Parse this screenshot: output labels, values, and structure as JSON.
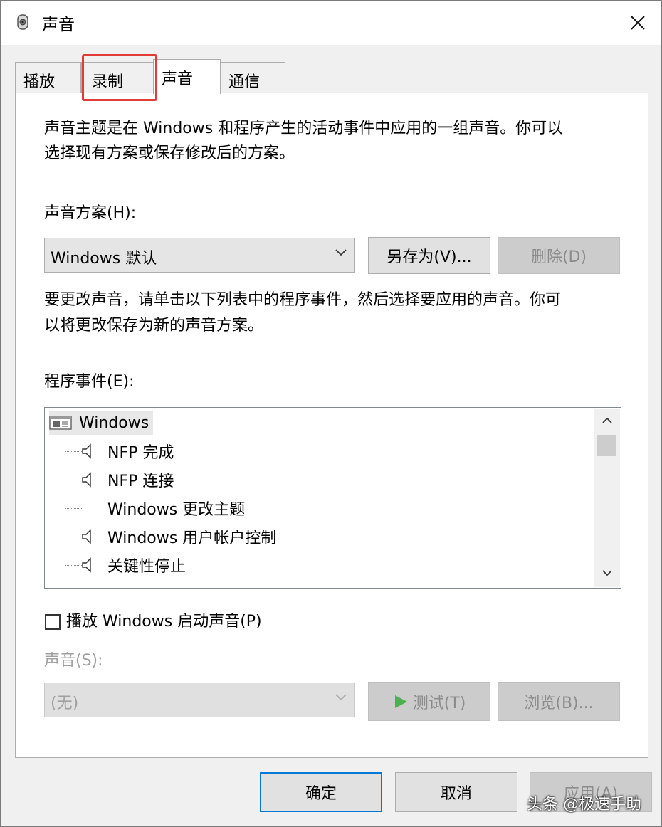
{
  "window": {
    "title": "声音",
    "icon": "speaker-icon"
  },
  "tabs": [
    {
      "label": "播放",
      "active": false
    },
    {
      "label": "录制",
      "active": false,
      "highlighted": true
    },
    {
      "label": "声音",
      "active": true
    },
    {
      "label": "通信",
      "active": false
    }
  ],
  "sounds_tab": {
    "description_line1": "声音主题是在 Windows 和程序产生的活动事件中应用的一组声音。你可以",
    "description_line2": "选择现有方案或保存修改后的方案。",
    "scheme_label": "声音方案(H):",
    "scheme_value": "Windows 默认",
    "save_as_label": "另存为(V)...",
    "delete_label": "删除(D)",
    "change_hint_line1": "要更改声音，请单击以下列表中的程序事件，然后选择要应用的声音。你可",
    "change_hint_line2": "以将更改保存为新的声音方案。",
    "events_label": "程序事件(E):",
    "events": [
      {
        "label": "Windows",
        "type": "group"
      },
      {
        "label": "NFP 完成",
        "has_sound": true
      },
      {
        "label": "NFP 连接",
        "has_sound": true
      },
      {
        "label": "Windows 更改主题",
        "has_sound": false
      },
      {
        "label": "Windows 用户帐户控制",
        "has_sound": true
      },
      {
        "label": "关键性停止",
        "has_sound": true
      }
    ],
    "startup_checkbox_label": "播放 Windows 启动声音(P)",
    "startup_checked": false,
    "sound_label": "声音(S):",
    "sound_value": "(无)",
    "test_label": "测试(T)",
    "browse_label": "浏览(B)..."
  },
  "footer": {
    "ok_label": "确定",
    "cancel_label": "取消",
    "apply_label": "应用(A)"
  },
  "watermark": "头条 @极速手助",
  "colors": {
    "highlight_border": "#e33a3a",
    "focus_border": "#0078d7",
    "play_icon": "#4caf50"
  }
}
